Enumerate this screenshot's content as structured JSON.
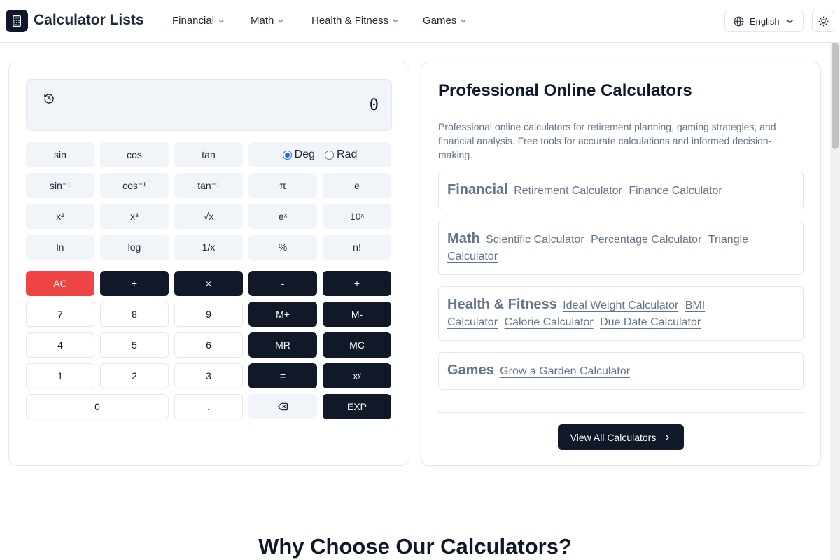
{
  "header": {
    "logo_icon": "calculator-icon",
    "title": "Calculator Lists",
    "nav": [
      {
        "label": "Financial"
      },
      {
        "label": "Math"
      },
      {
        "label": "Health & Fitness"
      },
      {
        "label": "Games"
      }
    ],
    "language": "English",
    "theme_icon": "sun-icon"
  },
  "calculator": {
    "display_value": "0",
    "history_icon": "history-icon",
    "angle_modes": {
      "deg": "Deg",
      "rad": "Rad",
      "selected": "Deg"
    },
    "keys": {
      "sin": "sin",
      "cos": "cos",
      "tan": "tan",
      "asin": "sin⁻¹",
      "acos": "cos⁻¹",
      "atan": "tan⁻¹",
      "pi": "π",
      "e": "e",
      "sq": "x²",
      "cube": "x³",
      "sqrt": "√x",
      "exp_e": "eˣ",
      "pow10": "10ˣ",
      "ln": "ln",
      "log": "log",
      "inv": "1/x",
      "pct": "%",
      "fact": "n!",
      "ac": "AC",
      "div": "÷",
      "mul": "×",
      "sub": "-",
      "add": "+",
      "n7": "7",
      "n8": "8",
      "n9": "9",
      "mplus": "M+",
      "mminus": "M-",
      "n4": "4",
      "n5": "5",
      "n6": "6",
      "mr": "MR",
      "mc": "MC",
      "n1": "1",
      "n2": "2",
      "n3": "3",
      "eq": "=",
      "pow": "xʸ",
      "n0": "0",
      "dot": ".",
      "backspace_icon": "backspace-icon",
      "exp": "EXP"
    }
  },
  "info": {
    "title": "Professional Online Calculators",
    "description": "Professional online calculators for retirement planning, gaming strategies, and financial analysis. Free tools for accurate calculations and informed decision-making.",
    "categories": [
      {
        "name": "Financial",
        "links": [
          "Retirement Calculator",
          "Finance Calculator"
        ]
      },
      {
        "name": "Math",
        "links": [
          "Scientific Calculator",
          "Percentage Calculator",
          "Triangle Calculator"
        ]
      },
      {
        "name": "Health & Fitness",
        "links": [
          "Ideal Weight Calculator",
          "BMI Calculator",
          "Calorie Calculator",
          "Due Date Calculator"
        ]
      },
      {
        "name": "Games",
        "links": [
          "Grow a Garden Calculator"
        ]
      }
    ],
    "view_all": "View All Calculators"
  },
  "why": {
    "title": "Why Choose Our Calculators?"
  }
}
